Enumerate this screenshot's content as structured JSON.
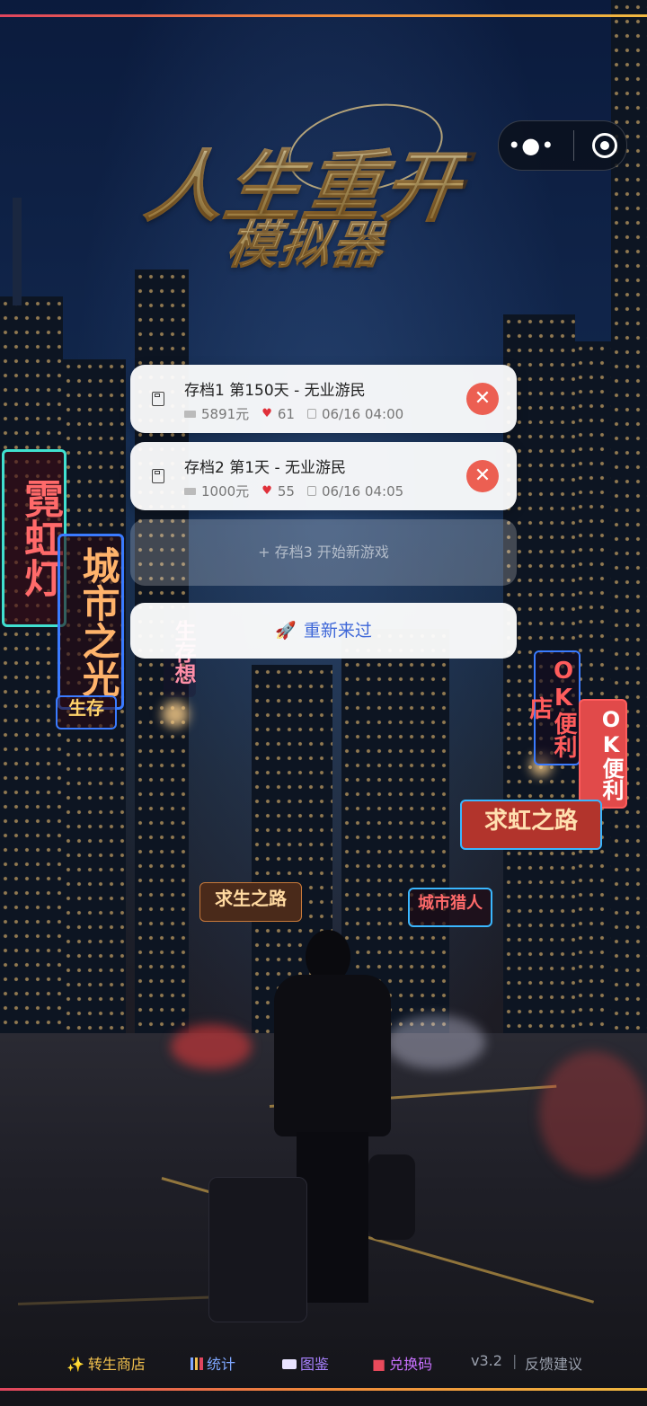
{
  "logo": {
    "line1": "人生重开",
    "line2": "模拟器"
  },
  "capsule": {
    "more_icon": "more-dots-icon",
    "close_icon": "target-close-icon"
  },
  "neon_signs": {
    "neon": "霓虹灯",
    "city": "城市之光",
    "survive": "生存",
    "survive_dream": "生存想",
    "ok_store1": "OK便利店",
    "ok_store2": "OK便利",
    "rainbow_road": "求虹之路",
    "seek_life_road": "求生之路",
    "city_hunter": "城市猎人"
  },
  "saves": [
    {
      "title": "存档1  第150天 - 无业游民",
      "money": "5891元",
      "health": "61",
      "time": "06/16 04:00"
    },
    {
      "title": "存档2  第1天 - 无业游民",
      "money": "1000元",
      "health": "55",
      "time": "06/16 04:05"
    }
  ],
  "new_slot": {
    "label": "+ 存档3 开始新游戏"
  },
  "restart": {
    "label": "重新来过"
  },
  "footer": {
    "shop": "转生商店",
    "stats": "统计",
    "gallery": "图鉴",
    "redeem": "兑换码",
    "version": "v3.2",
    "feedback": "反馈建议"
  },
  "colors": {
    "accent_blue": "#3f68d8",
    "delete_red": "#ec5f52",
    "shop_gold": "#f2c14e",
    "stats_blue": "#7fa7ff",
    "gallery_purple": "#a982ff",
    "redeem_pink": "#c971ff"
  }
}
